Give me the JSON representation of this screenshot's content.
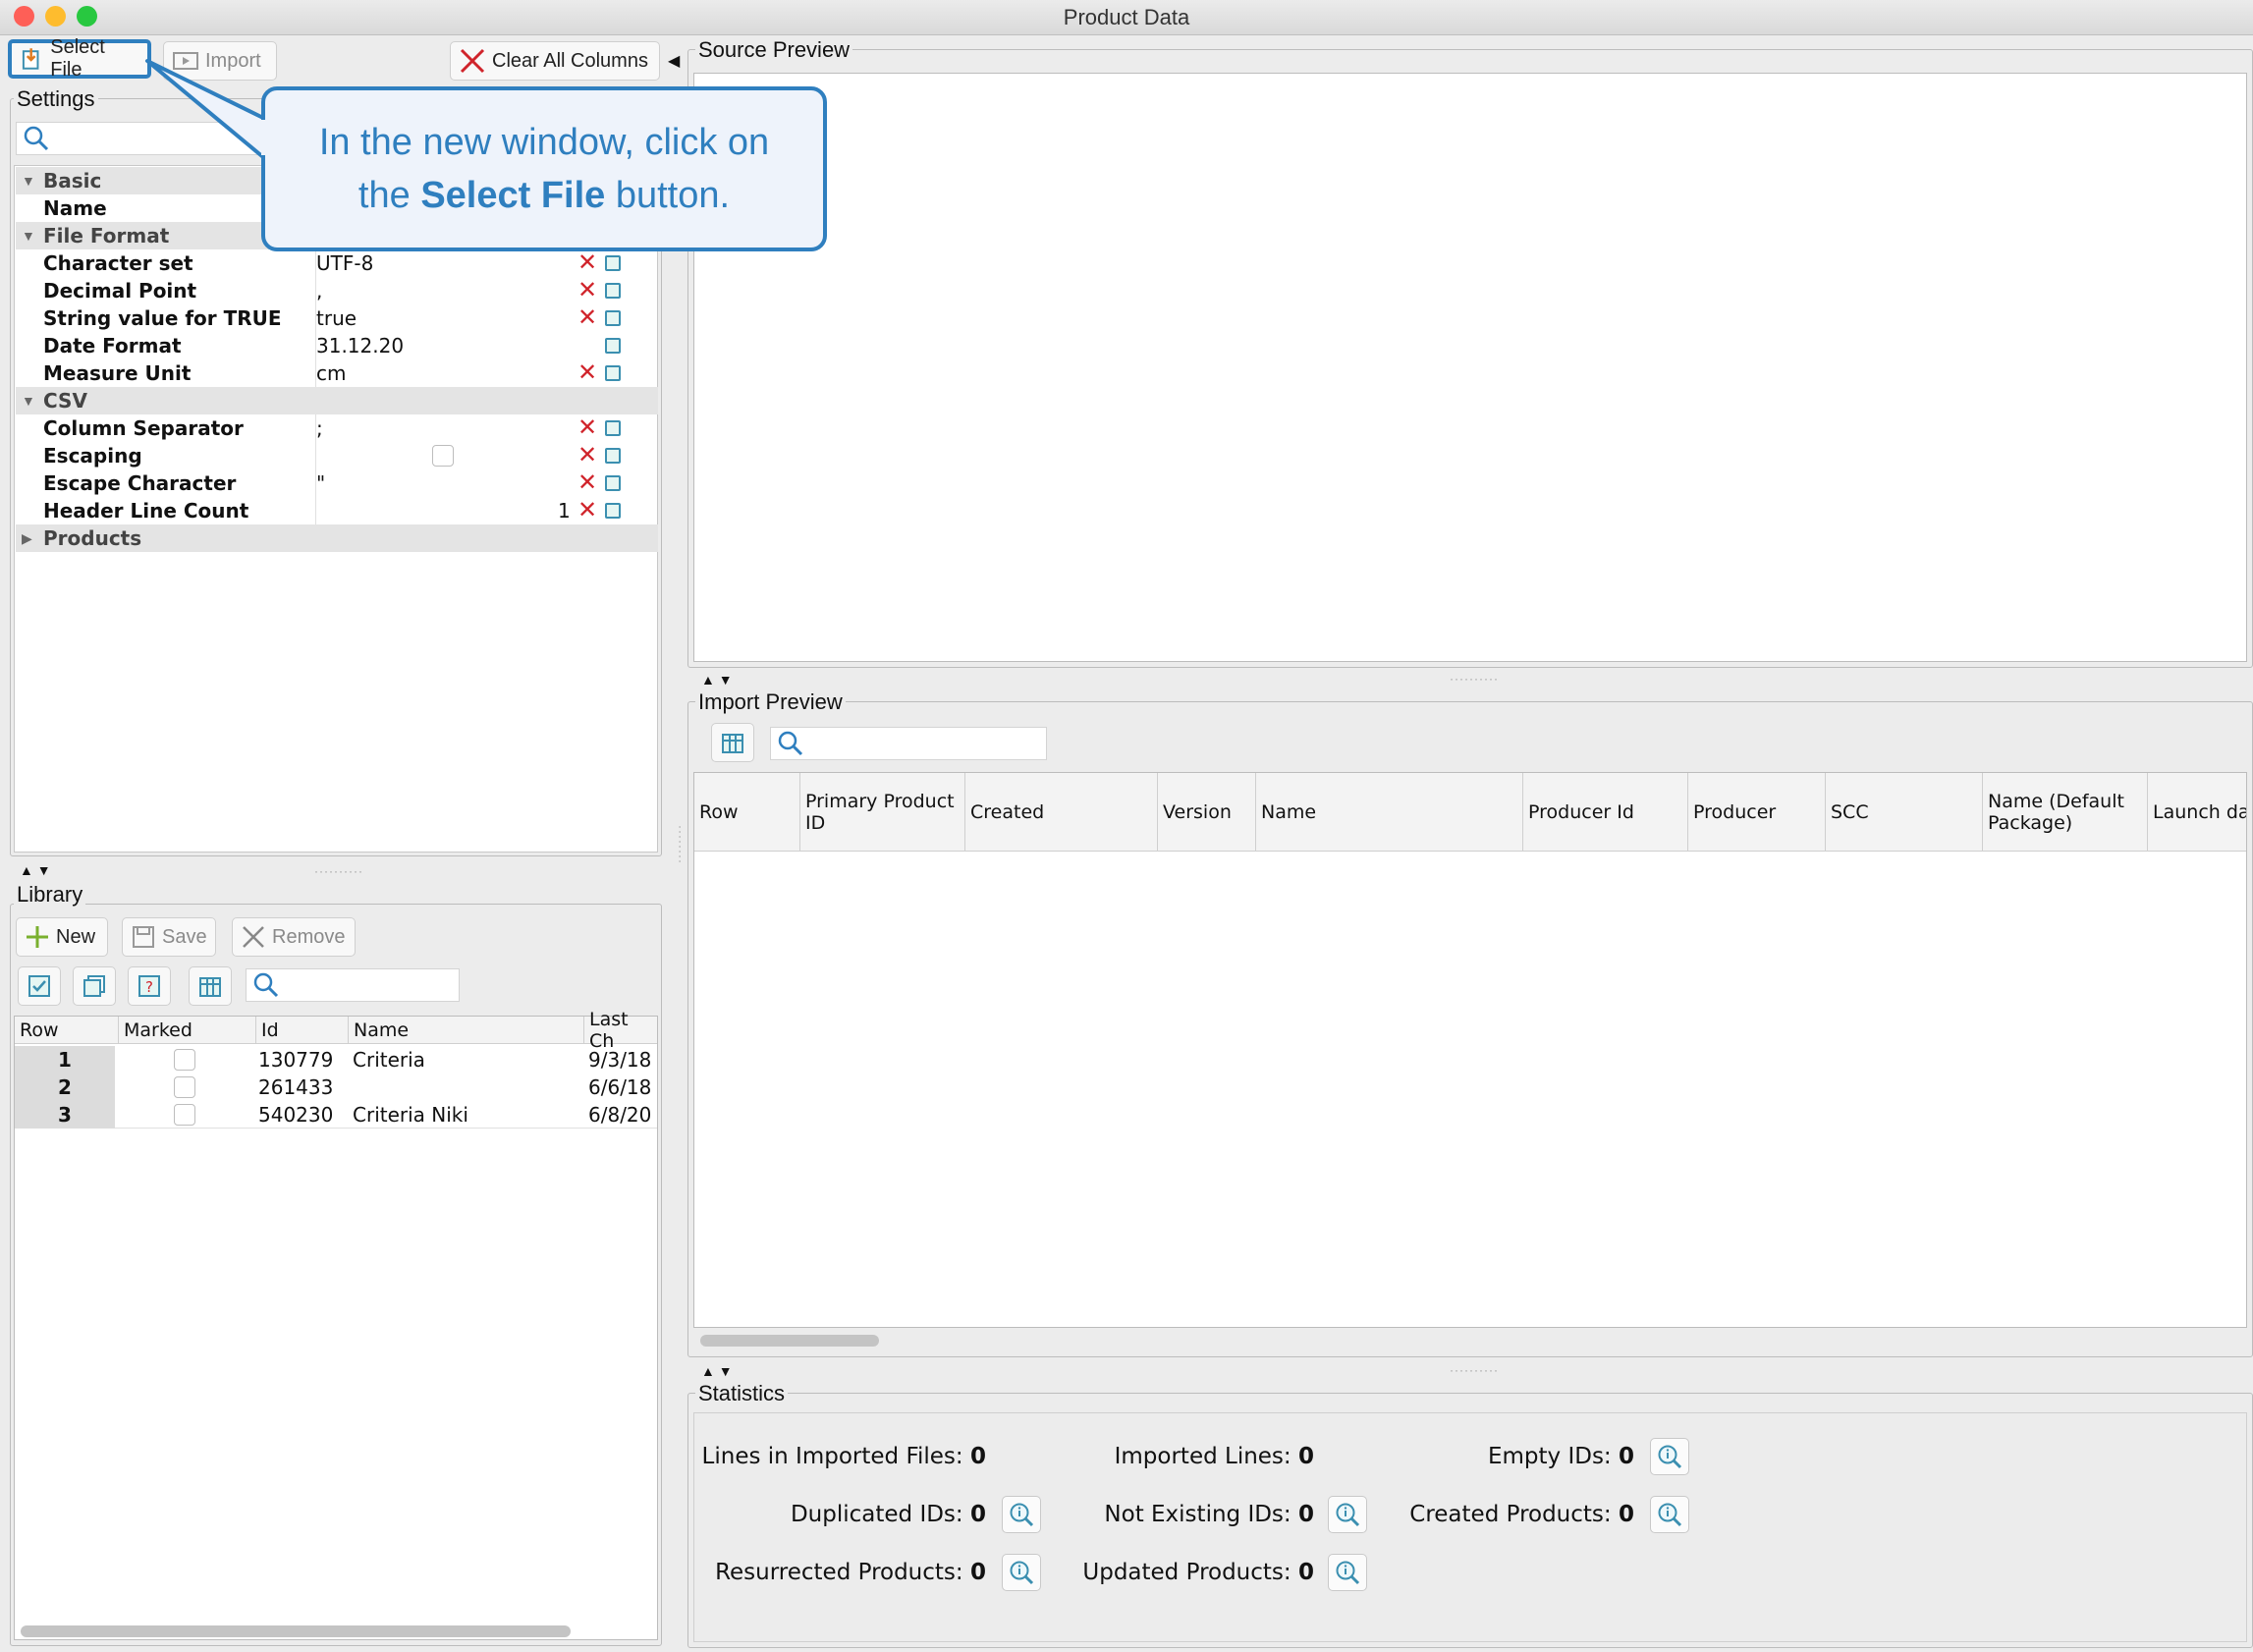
{
  "window": {
    "title": "Product Data"
  },
  "toolbar": {
    "select_file": "Select File",
    "import": "Import",
    "clear_all_columns": "Clear All Columns"
  },
  "callout": {
    "text_pre": "In the new window, click on the ",
    "text_bold": "Select File",
    "text_post": " button."
  },
  "settings": {
    "title": "Settings",
    "cat_basic": "Basic",
    "name_label": "Name",
    "cat_file_format": "File Format",
    "charset_label": "Character set",
    "charset_value": "UTF-8",
    "decimal_label": "Decimal Point",
    "decimal_value": ",",
    "truestr_label": "String value for TRUE",
    "truestr_value": "true",
    "datefmt_label": "Date Format",
    "datefmt_value": "31.12.20",
    "measure_label": "Measure Unit",
    "measure_value": "cm",
    "cat_csv": "CSV",
    "colsep_label": "Column Separator",
    "colsep_value": ";",
    "escaping_label": "Escaping",
    "escchar_label": "Escape Character",
    "escchar_value": "\"",
    "header_label": "Header Line Count",
    "header_value": "1",
    "cat_products": "Products"
  },
  "library": {
    "title": "Library",
    "new": "New",
    "save": "Save",
    "remove": "Remove",
    "columns": [
      "Row",
      "Marked",
      "Id",
      "Name",
      "Last Ch"
    ],
    "rows": [
      {
        "row": "1",
        "id": "130779",
        "name": "Criteria",
        "last": "9/3/18"
      },
      {
        "row": "2",
        "id": "261433",
        "name": "",
        "last": "6/6/18"
      },
      {
        "row": "3",
        "id": "540230",
        "name": "Criteria Niki",
        "last": "6/8/20"
      }
    ]
  },
  "source_preview": {
    "title": "Source Preview"
  },
  "import_preview": {
    "title": "Import Preview",
    "columns": {
      "row": "Row",
      "primary_1": "Primary Product",
      "primary_2": "ID",
      "created": "Created",
      "version": "Version",
      "name": "Name",
      "producer_id": "Producer Id",
      "producer": "Producer",
      "scc": "SCC",
      "name_default_1": "Name (Default",
      "name_default_2": "Package)",
      "launch": "Launch da"
    }
  },
  "statistics": {
    "title": "Statistics",
    "lines_imported_files": "Lines in Imported Files:",
    "lines_imported_files_v": "0",
    "imported_lines": "Imported Lines:",
    "imported_lines_v": "0",
    "empty_ids": "Empty IDs:",
    "empty_ids_v": "0",
    "duplicated_ids": "Duplicated IDs:",
    "duplicated_ids_v": "0",
    "not_existing_ids": "Not Existing IDs:",
    "not_existing_ids_v": "0",
    "created_products": "Created Products:",
    "created_products_v": "0",
    "resurrected_products": "Resurrected Products:",
    "resurrected_products_v": "0",
    "updated_products": "Updated Products:",
    "updated_products_v": "0"
  },
  "icons": {
    "select_file": "file-open-icon",
    "import": "import-icon",
    "clear": "close-icon",
    "search": "search-icon",
    "new": "plus-icon",
    "save": "floppy-icon",
    "remove": "close-icon",
    "info_zoom": "magnifier-info-icon",
    "columns": "columns-icon"
  },
  "colors": {
    "callout_border": "#2f7fbf",
    "callout_text": "#2f7fbf",
    "clear_x": "#d0242b",
    "highlight": "#2f7fbf"
  }
}
